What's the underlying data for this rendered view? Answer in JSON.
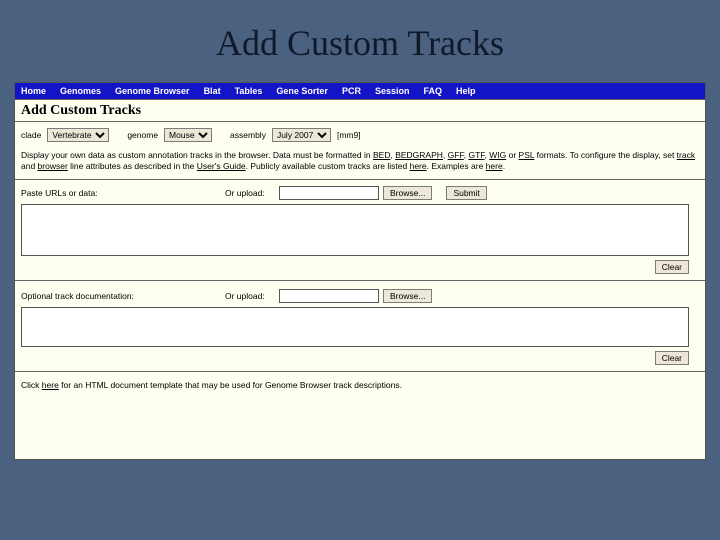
{
  "slide": {
    "title": "Add Custom Tracks"
  },
  "nav": {
    "items": [
      "Home",
      "Genomes",
      "Genome Browser",
      "Blat",
      "Tables",
      "Gene Sorter",
      "PCR",
      "Session",
      "FAQ",
      "Help"
    ]
  },
  "heading": "Add Custom Tracks",
  "selectors": {
    "clade_label": "clade",
    "clade_value": "Vertebrate",
    "genome_label": "genome",
    "genome_value": "Mouse",
    "assembly_label": "assembly",
    "assembly_value": "July 2007",
    "assembly_id": "[mm9]"
  },
  "description": {
    "pre": "Display your own data as custom annotation tracks in the browser. Data must be formatted in ",
    "fmt": [
      "BED",
      "BEDGRAPH",
      "GFF",
      "GTF",
      "WIG",
      "PSL"
    ],
    "sep_comma": ", ",
    "sep_or": " or ",
    "after_formats": " formats. To configure the display, set ",
    "track": "track",
    "and": " and ",
    "browser": "browser",
    "after_tb": " line attributes as described in the ",
    "ug": "User's Guide",
    "after_ug": ". Publicly available custom tracks are listed ",
    "here1": "here",
    "after_here1": ". Examples are ",
    "here2": "here",
    "period": "."
  },
  "upload1": {
    "label": "Paste URLs or data:",
    "or": "Or upload:",
    "browse": "Browse...",
    "submit": "Submit",
    "clear": "Clear"
  },
  "upload2": {
    "label": "Optional track documentation:",
    "or": "Or upload:",
    "browse": "Browse...",
    "clear": "Clear"
  },
  "footer": {
    "pre": "Click ",
    "here": "here",
    "post": " for an HTML document template that may be used for Genome Browser track descriptions."
  }
}
